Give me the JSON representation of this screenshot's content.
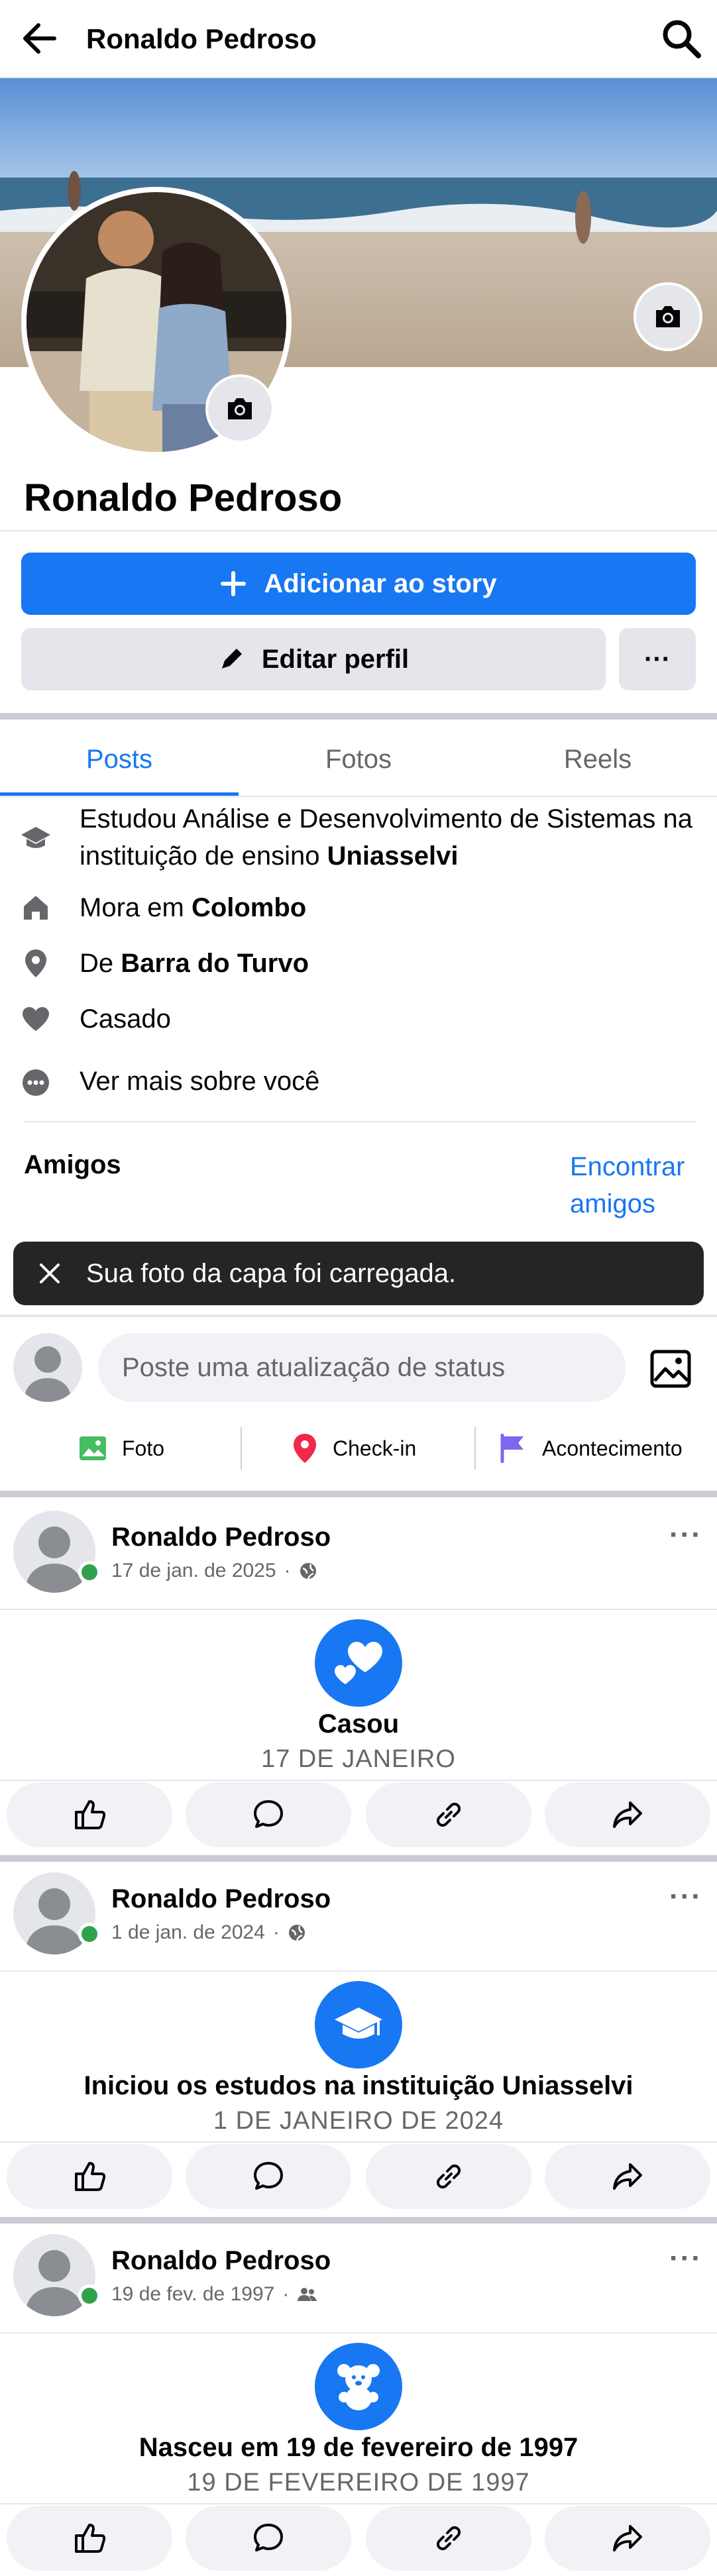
{
  "header": {
    "title": "Ronaldo Pedroso",
    "back_icon": "arrow-left-icon",
    "search_icon": "search-icon"
  },
  "profile": {
    "name": "Ronaldo Pedroso",
    "add_story_label": "Adicionar ao story",
    "edit_profile_label": "Editar perfil",
    "more_label": "···"
  },
  "tabs": [
    {
      "label": "Posts",
      "active": true
    },
    {
      "label": "Fotos",
      "active": false
    },
    {
      "label": "Reels",
      "active": false
    }
  ],
  "intro": {
    "education_prefix": "Estudou Análise e Desenvolvimento de Sistemas na instituição de ensino ",
    "education_school": "Uniasselvi",
    "lives_prefix": "Mora em ",
    "lives_city": "Colombo",
    "from_prefix": "De ",
    "from_city": "Barra do Turvo",
    "relationship": "Casado",
    "see_more": "Ver mais sobre você"
  },
  "friends": {
    "title": "Amigos",
    "find_link": "Encontrar amigos"
  },
  "toast": {
    "text": "Sua foto da capa foi carregada."
  },
  "composer": {
    "placeholder": "Poste uma atualização de status",
    "actions": [
      {
        "label": "Foto",
        "icon": "photo-icon",
        "color": "#45bd62"
      },
      {
        "label": "Check-in",
        "icon": "location-pin-icon",
        "color": "#f02849"
      },
      {
        "label": "Acontecimento",
        "icon": "flag-icon",
        "color": "#7b68ee"
      }
    ]
  },
  "posts": [
    {
      "author": "Ronaldo Pedroso",
      "date": "17 de jan. de 2025",
      "privacy": "globe-icon",
      "event_icon": "hearts-icon",
      "event_title": "Casou",
      "event_date": "17 DE JANEIRO"
    },
    {
      "author": "Ronaldo Pedroso",
      "date": "1 de jan. de 2024",
      "privacy": "globe-icon",
      "event_icon": "graduation-cap-icon",
      "event_title": "Iniciou os estudos na instituição Uniasselvi",
      "event_date": "1 DE JANEIRO DE 2024"
    },
    {
      "author": "Ronaldo Pedroso",
      "date": "19 de fev. de 1997",
      "privacy": "friends-icon",
      "event_icon": "teddy-bear-icon",
      "event_title": "Nasceu em 19 de fevereiro de 1997",
      "event_date": "19 DE FEVEREIRO DE 1997"
    }
  ],
  "colors": {
    "accent": "#1877f2",
    "online": "#31a24c",
    "muted": "#65676b",
    "button_bg": "#e4e6eb"
  }
}
